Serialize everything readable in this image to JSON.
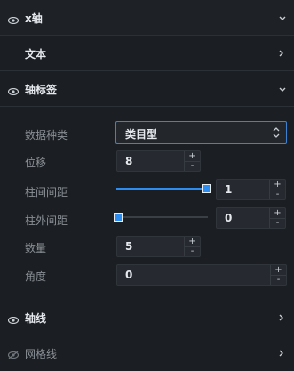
{
  "sections": {
    "x_axis": {
      "title": "x轴"
    },
    "text": {
      "title": "文本"
    },
    "axis_label": {
      "title": "轴标签"
    },
    "axis_line": {
      "title": "轴线"
    },
    "grid_line": {
      "title": "网格线"
    }
  },
  "fields": {
    "data_type": {
      "label": "数据种类",
      "value": "类目型"
    },
    "offset": {
      "label": "位移",
      "value": "8"
    },
    "bar_inner_gap": {
      "label": "柱间间距",
      "value": "1",
      "slider_fraction": 1.0
    },
    "bar_outer_gap": {
      "label": "柱外间距",
      "value": "0",
      "slider_fraction": 0.0
    },
    "count": {
      "label": "数量",
      "value": "5"
    },
    "angle": {
      "label": "角度",
      "value": "0"
    }
  },
  "stepper": {
    "plus": "+",
    "minus": "-"
  },
  "colors": {
    "accent": "#2d8cf0",
    "bg": "#1b1e22"
  }
}
